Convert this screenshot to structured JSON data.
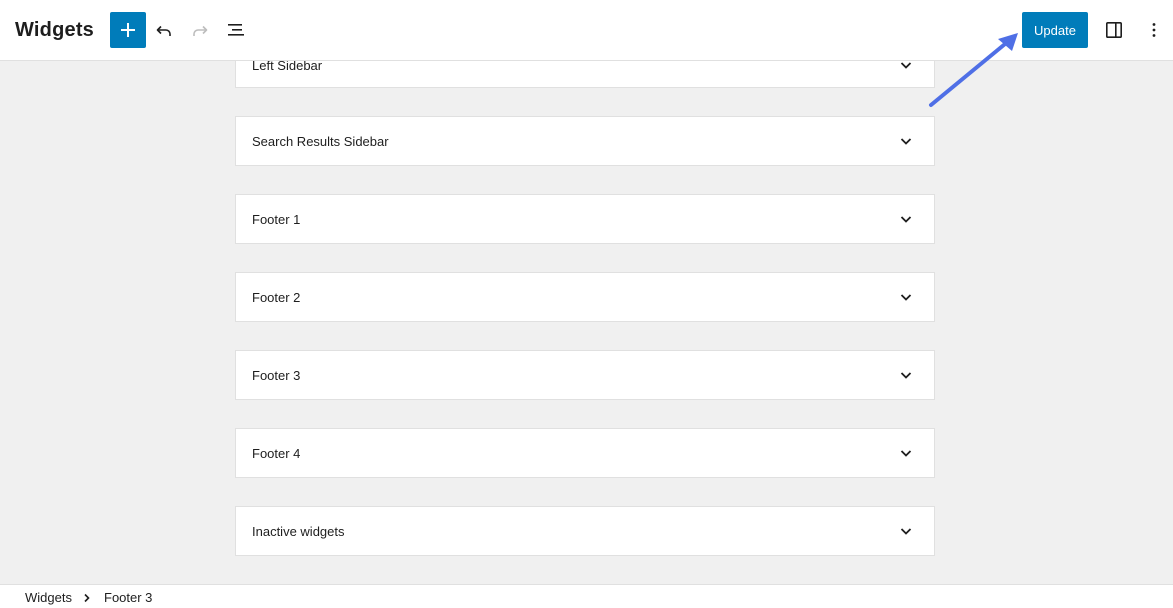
{
  "header": {
    "title": "Widgets",
    "tools": [
      {
        "name": "add-block-button",
        "icon": "plus-icon"
      },
      {
        "name": "undo-button",
        "icon": "undo-icon"
      },
      {
        "name": "redo-button",
        "icon": "redo-icon",
        "disabled": true
      },
      {
        "name": "list-view-button",
        "icon": "list-view-icon"
      }
    ],
    "update_label": "Update",
    "settings_icon": "sidebar-toggle-icon",
    "options_icon": "more-vertical-icon",
    "accent": "#007cba"
  },
  "panels": [
    {
      "label": "Left Sidebar"
    },
    {
      "label": "Search Results Sidebar"
    },
    {
      "label": "Footer 1"
    },
    {
      "label": "Footer 2"
    },
    {
      "label": "Footer 3"
    },
    {
      "label": "Footer 4"
    },
    {
      "label": "Inactive widgets"
    }
  ],
  "breadcrumb": {
    "items": [
      "Widgets",
      "Footer 3"
    ],
    "separator_icon": "chevron-right-icon"
  },
  "annotation": {
    "icon": "pointer-arrow-icon",
    "color": "#4f6fe6"
  }
}
